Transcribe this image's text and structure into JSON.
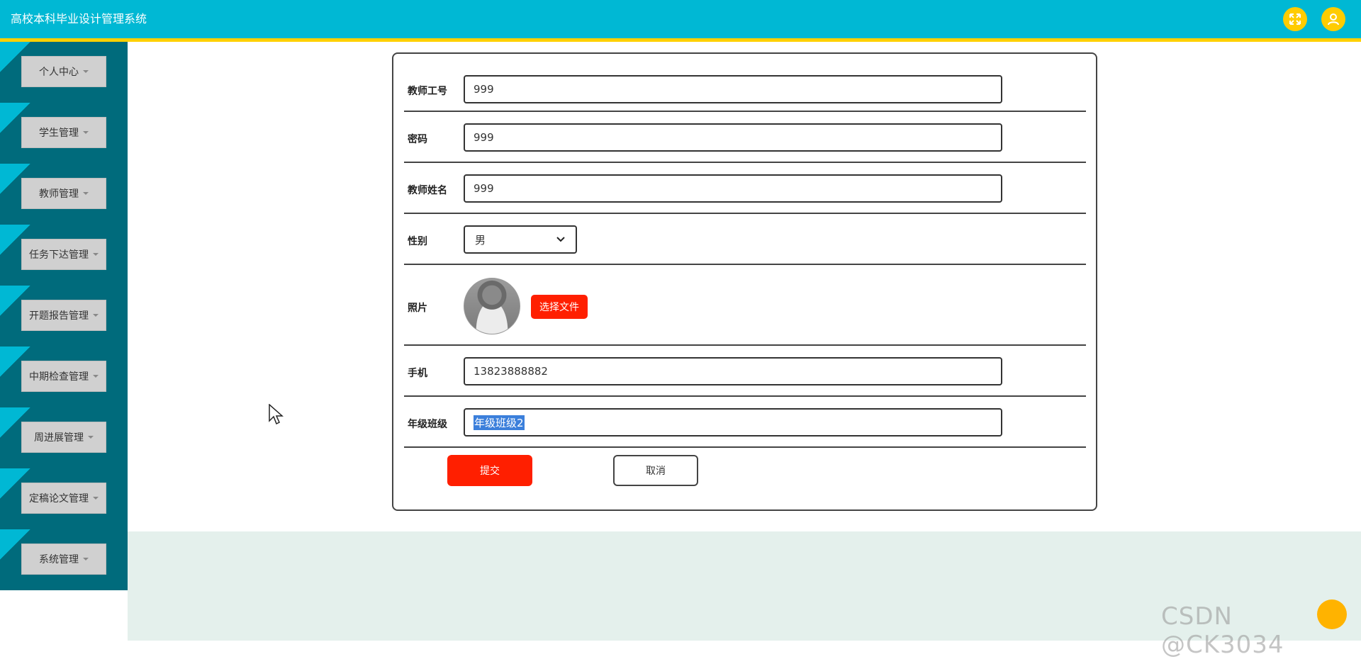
{
  "header": {
    "title": "高校本科毕业设计管理系统",
    "icons": [
      "fullscreen-icon",
      "user-icon"
    ]
  },
  "colors": {
    "header_bg": "#00b8d4",
    "accent": "#ffd000",
    "sidebar_dark": "#006b7c",
    "primary_red": "#ff1f00",
    "icon_yellow": "#ffcc00"
  },
  "sidebar": {
    "items": [
      {
        "label": "个人中心"
      },
      {
        "label": "学生管理"
      },
      {
        "label": "教师管理"
      },
      {
        "label": "任务下达管理"
      },
      {
        "label": "开题报告管理"
      },
      {
        "label": "中期检查管理"
      },
      {
        "label": "周进展管理"
      },
      {
        "label": "定稿论文管理"
      },
      {
        "label": "系统管理"
      }
    ]
  },
  "form": {
    "teacher_id": {
      "label": "教师工号",
      "value": "999"
    },
    "password": {
      "label": "密码",
      "value": "999"
    },
    "teacher_name": {
      "label": "教师姓名",
      "value": "999"
    },
    "gender": {
      "label": "性别",
      "value": "男"
    },
    "photo": {
      "label": "照片",
      "button": "选择文件"
    },
    "phone": {
      "label": "手机",
      "value": "13823888882"
    },
    "class": {
      "label": "年级班级",
      "value": "年级班级2"
    },
    "submit_label": "提交",
    "cancel_label": "取消"
  },
  "watermark": "CSDN @CK3034"
}
